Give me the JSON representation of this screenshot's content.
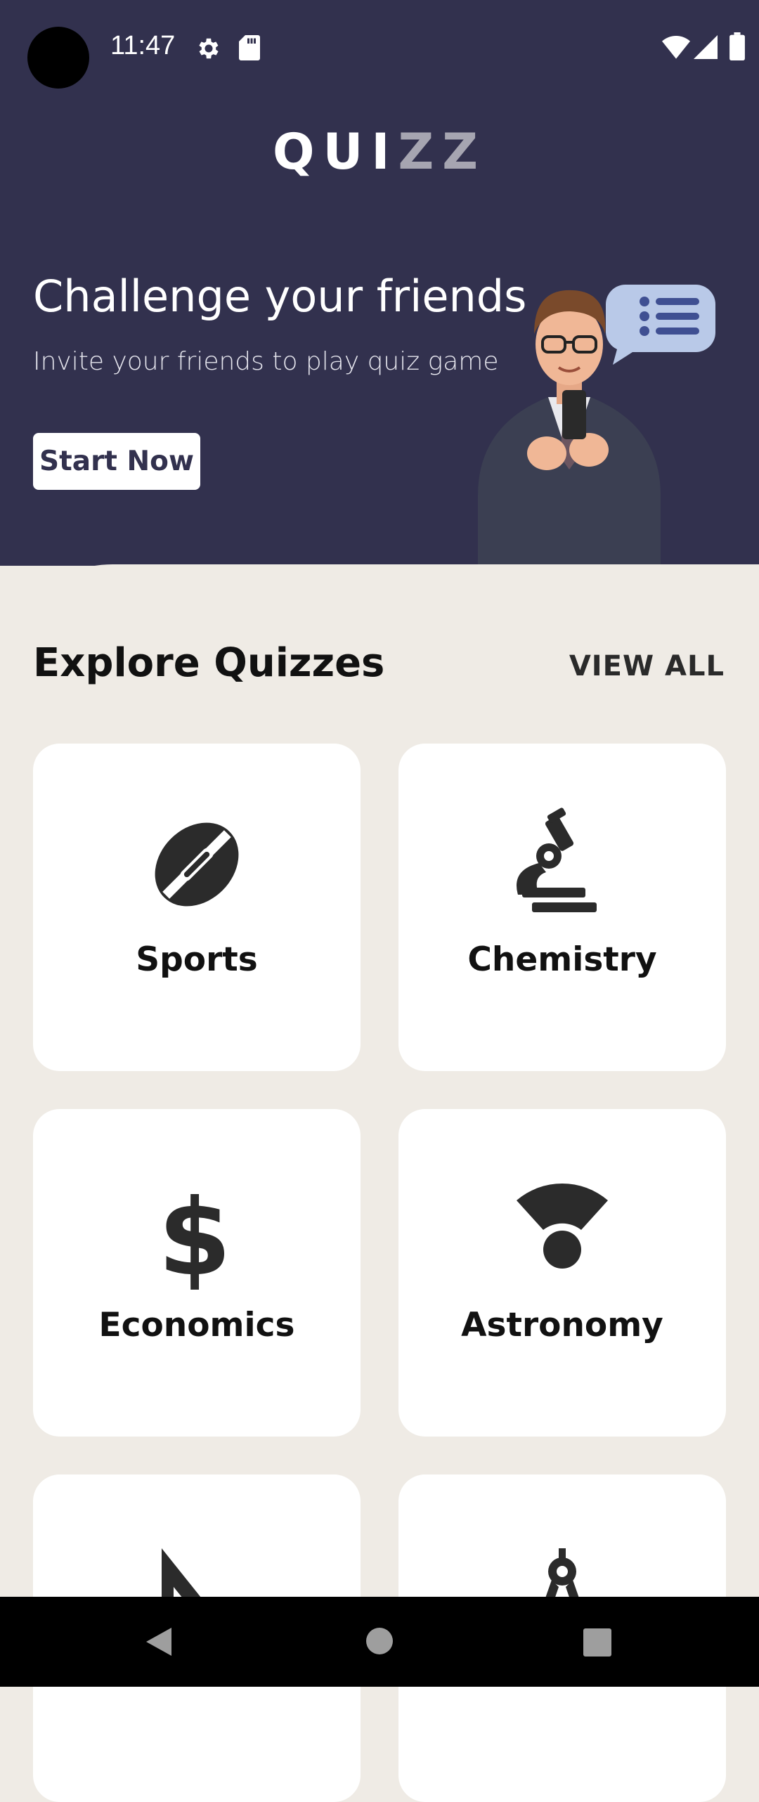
{
  "status_bar": {
    "time": "11:47",
    "icons": [
      "settings-icon",
      "sd-card-icon",
      "wifi-icon",
      "signal-icon",
      "battery-icon"
    ]
  },
  "app": {
    "logo_primary": "QUI",
    "logo_secondary": "ZZ"
  },
  "hero": {
    "title": "Challenge your friends",
    "subtitle": "Invite your friends to play quiz game",
    "button_label": "Start Now"
  },
  "explore": {
    "title": "Explore Quizzes",
    "view_all": "VIEW ALL",
    "cards": [
      {
        "label": "Sports",
        "icon": "football-icon"
      },
      {
        "label": "Chemistry",
        "icon": "microscope-icon"
      },
      {
        "label": "Economics",
        "icon": "dollar-icon"
      },
      {
        "label": "Astronomy",
        "icon": "satellite-dish-icon"
      },
      {
        "label": "",
        "icon": "ruler-triangle-icon"
      },
      {
        "label": "",
        "icon": "compass-icon"
      }
    ]
  },
  "nav_bar": {
    "icons": [
      "back-icon",
      "home-icon",
      "recents-icon"
    ]
  },
  "colors": {
    "hero_bg": "#32314E",
    "content_bg": "#EFEBE5",
    "card_bg": "#FFFFFF",
    "icon": "#2B2B2B"
  }
}
